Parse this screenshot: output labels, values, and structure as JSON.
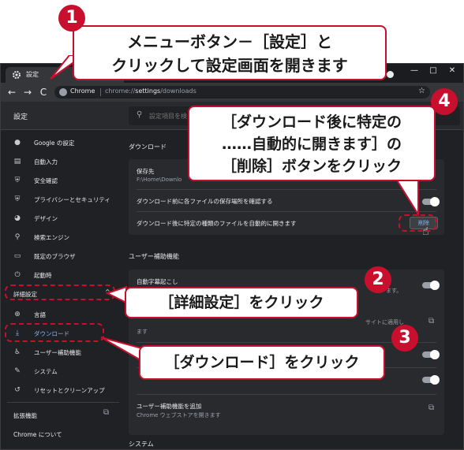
{
  "tab": {
    "title": "設定"
  },
  "window_controls": {
    "minimize": "—",
    "maximize": "□",
    "close": "✕"
  },
  "toolbar": {
    "back": "←",
    "forward": "→",
    "reload": "C",
    "site": "Chrome",
    "url_prefix": "chrome://",
    "url_host": "settings",
    "url_path": "/downloads",
    "star": "☆"
  },
  "header": {
    "title": "設定",
    "search_placeholder": "設定項目を検"
  },
  "sidebar": {
    "items": [
      {
        "label": "Google の設定",
        "icon": "person-icon"
      },
      {
        "label": "自動入力",
        "icon": "clipboard-icon"
      },
      {
        "label": "安全確認",
        "icon": "shield-icon"
      },
      {
        "label": "プライバシーとセキュリティ",
        "icon": "shield-lock-icon"
      },
      {
        "label": "デザイン",
        "icon": "palette-icon"
      },
      {
        "label": "検索エンジン",
        "icon": "search-icon"
      },
      {
        "label": "既定のブラウザ",
        "icon": "browser-icon"
      },
      {
        "label": "起動時",
        "icon": "power-icon"
      }
    ],
    "advanced_label": "詳細設定",
    "advanced_items": [
      {
        "label": "言語",
        "icon": "globe-icon"
      },
      {
        "label": "ダウンロード",
        "icon": "download-icon"
      },
      {
        "label": "ユーザー補助機能",
        "icon": "accessibility-icon"
      },
      {
        "label": "システム",
        "icon": "wrench-icon"
      },
      {
        "label": "リセットとクリーンアップ",
        "icon": "reset-icon"
      }
    ],
    "extensions_label": "拡張機能",
    "about_label": "Chrome について"
  },
  "main": {
    "downloads_title": "ダウンロード",
    "location_label": "保存先",
    "location_value": "F:\\Home\\Downlo",
    "ask_label": "ダウンロード前に各ファイルの保存場所を確認する",
    "auto_open_label": "ダウンロード後に特定の種類のファイルを自動的に開きます",
    "delete_button": "削除",
    "a11y_title": "ユーザー補助機能",
    "live_caption_label": "自動字幕起こし",
    "live_caption_tail": "ます。",
    "a11y_row2_tail": "サイトに適用し",
    "a11y_row2_tail2": "ます",
    "add_a11y_label": "ユーザー補助機能を追加",
    "add_a11y_sub": "Chrome ウェブストアを開きます",
    "system_title": "システム"
  },
  "annotations": {
    "callout1": {
      "number": "1",
      "line1": "メニューボタン－［設定］と",
      "line2": "クリックして設定画面を開きます"
    },
    "callout2": {
      "number": "2",
      "text": "［詳細設定］をクリック"
    },
    "callout3": {
      "number": "3",
      "text": "［ダウンロード］をクリック"
    },
    "callout4": {
      "number": "4",
      "line1": "［ダウンロード後に特定の",
      "line2": "……自動的に開きます］の",
      "line3": "［削除］ボタンをクリック"
    }
  },
  "colors": {
    "accent_red": "#c8102e",
    "link_blue": "#8ab4f8",
    "bg_dark": "#202124"
  }
}
